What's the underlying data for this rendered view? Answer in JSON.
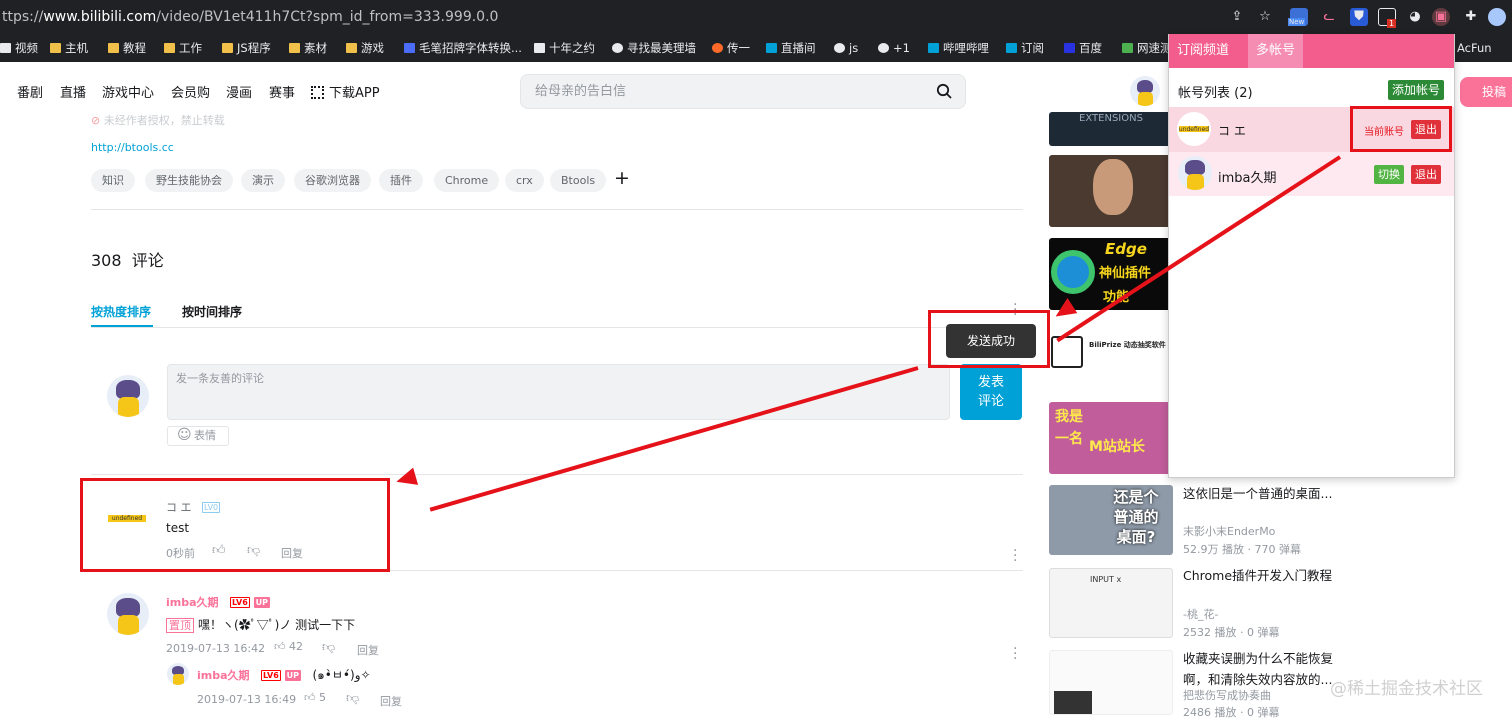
{
  "browser": {
    "url_prefix": "ttps://",
    "url_host": "www.bilibili.com",
    "url_path": "/video/BV1et411h7Ct?spm_id_from=333.999.0.0",
    "ext_new_badge": "New",
    "ext_count_badge": "1"
  },
  "bookmarks": [
    "视频",
    "主机",
    "教程",
    "工作",
    "JS程序",
    "素材",
    "游戏",
    "毛笔招牌字体转换...",
    "十年之约",
    "寻找最美理墙",
    "传一",
    "直播间",
    "js",
    "+1",
    "哔哩哔哩",
    "订阅",
    "百度",
    "网速测",
    "AcFun"
  ],
  "nav": {
    "items": [
      "番剧",
      "直播",
      "游戏中心",
      "会员购",
      "漫画",
      "赛事"
    ],
    "download_app": "下载APP",
    "search_placeholder": "给母亲的告白信"
  },
  "video": {
    "faded_notice": "未经作者授权，禁止转载",
    "link": "http://btools.cc",
    "tags": [
      "知识",
      "野生技能协会",
      "演示",
      "谷歌浏览器",
      "插件",
      "Chrome",
      "crx",
      "Btools"
    ],
    "add_tag": "+"
  },
  "comments": {
    "count": "308",
    "title": "评论",
    "sort_hot": "按热度排序",
    "sort_time": "按时间排序",
    "input_placeholder": "发一条友善的评论",
    "send_label_1": "发表",
    "send_label_2": "评论",
    "emoji_label": "表情",
    "toast": "发送成功",
    "items": [
      {
        "user": "コ エ",
        "level": "LV0",
        "text": "test",
        "time": "0秒前",
        "reply": "回复",
        "avatar_text": "undefined"
      },
      {
        "user": "imba久期",
        "level": "LV6",
        "up_badge": "UP",
        "pinned": "置顶",
        "text": "嘿！ヽ(✿ﾟ▽ﾟ)ノ 测试一下下",
        "time": "2019-07-13 16:42",
        "likes": "42",
        "reply": "回复"
      },
      {
        "user": "imba久期",
        "level": "LV6",
        "up_badge": "UP",
        "text": "(๑•̀ㅂ•́)و✧",
        "time": "2019-07-13 16:49",
        "likes": "5",
        "reply": "回复"
      }
    ]
  },
  "sidebar": {
    "thumb_texts": [
      "EXTENSIONS",
      "Edge",
      "神仙插件",
      "功能",
      "BiliPrize 动态抽奖软件",
      "我是",
      "一名",
      "M站站长",
      "还是个",
      "普通的",
      "桌面?",
      "INPUT x"
    ],
    "recs": [
      {
        "title": "这依旧是一个普通的桌面...",
        "author": "末影小末EnderMo",
        "stats": "52.9万 播放 · 770 弹幕"
      },
      {
        "title": "Chrome插件开发入门教程",
        "author": "-桃_花-",
        "stats": "2532 播放 · 0 弹幕"
      },
      {
        "title": "收藏夹误删为什么不能恢复啊，和清除失效内容放的...",
        "author": "把悲伤写成协奏曲",
        "stats": "2486 播放 · 0 弹幕"
      }
    ]
  },
  "popup": {
    "tab_subscribe": "订阅频道",
    "tab_multi": "多帐号",
    "list_title": "帐号列表 (2)",
    "add_btn": "添加帐号",
    "accounts": [
      {
        "name": "コ エ",
        "status": "当前账号",
        "logout": "退出",
        "avatar_text": "undefined"
      },
      {
        "name": "imba久期",
        "switch": "切换",
        "logout": "退出"
      }
    ],
    "upload_btn": "投稿"
  },
  "watermark": "@稀土掘金技术社区",
  "colors": {
    "bili_blue": "#00a1d6",
    "bili_pink": "#fb7299",
    "annotation_red": "#e5121a",
    "popup_pink": "#f25d8e"
  }
}
